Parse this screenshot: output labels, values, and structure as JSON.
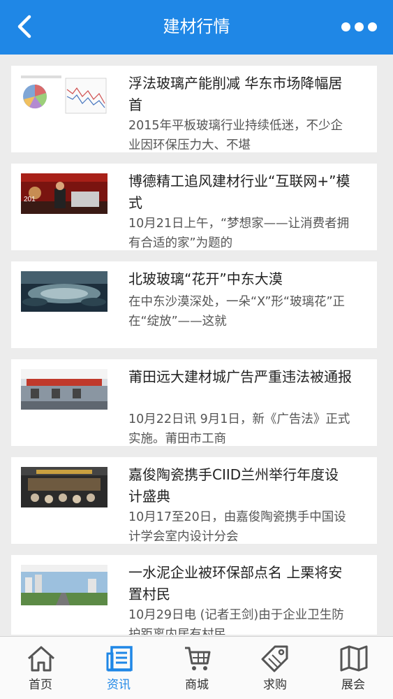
{
  "header": {
    "title": "建材行情",
    "back_icon": "back-arrow-icon",
    "more_icon": "more-dots-icon",
    "color": "#1f87e6"
  },
  "news": [
    {
      "title": "浮法玻璃产能削减 华东市场降幅居首",
      "summary": "2015年平板玻璃行业持续低迷，不少企业因环保压力大、不堪",
      "thumb": "chart-thumbnail"
    },
    {
      "title": "博德精工追风建材行业“互联网+”模式",
      "summary": "10月21日上午，“梦想家——让消费者拥有合适的家”为题的",
      "thumb": "conference-photo"
    },
    {
      "title": "北玻玻璃“花开”中东大漠",
      "summary": "在中东沙漠深处，一朵“X”形“玻璃花”正在“绽放”——这就",
      "thumb": "building-photo"
    },
    {
      "title": "莆田远大建材城广告严重违法被通报",
      "summary": "10月22日讯 9月1日，新《广告法》正式实施。莆田市工商",
      "thumb": "market-photo"
    },
    {
      "title": "嘉俊陶瓷携手CIID兰州举行年度设计盛典",
      "summary": "10月17至20日，由嘉俊陶瓷携手中国设计学会室内设计分会",
      "thumb": "event-photo"
    },
    {
      "title": "一水泥企业被环保部点名 上栗将安置村民",
      "summary": "10月29日电 (记者王剑)由于企业卫生防护距离内居有村民",
      "thumb": "city-photo"
    }
  ],
  "nav": [
    {
      "label": "首页",
      "icon": "home-icon"
    },
    {
      "label": "资讯",
      "icon": "news-icon"
    },
    {
      "label": "商城",
      "icon": "cart-icon"
    },
    {
      "label": "求购",
      "icon": "tag-icon"
    },
    {
      "label": "展会",
      "icon": "map-icon"
    }
  ],
  "nav_active": "资讯"
}
